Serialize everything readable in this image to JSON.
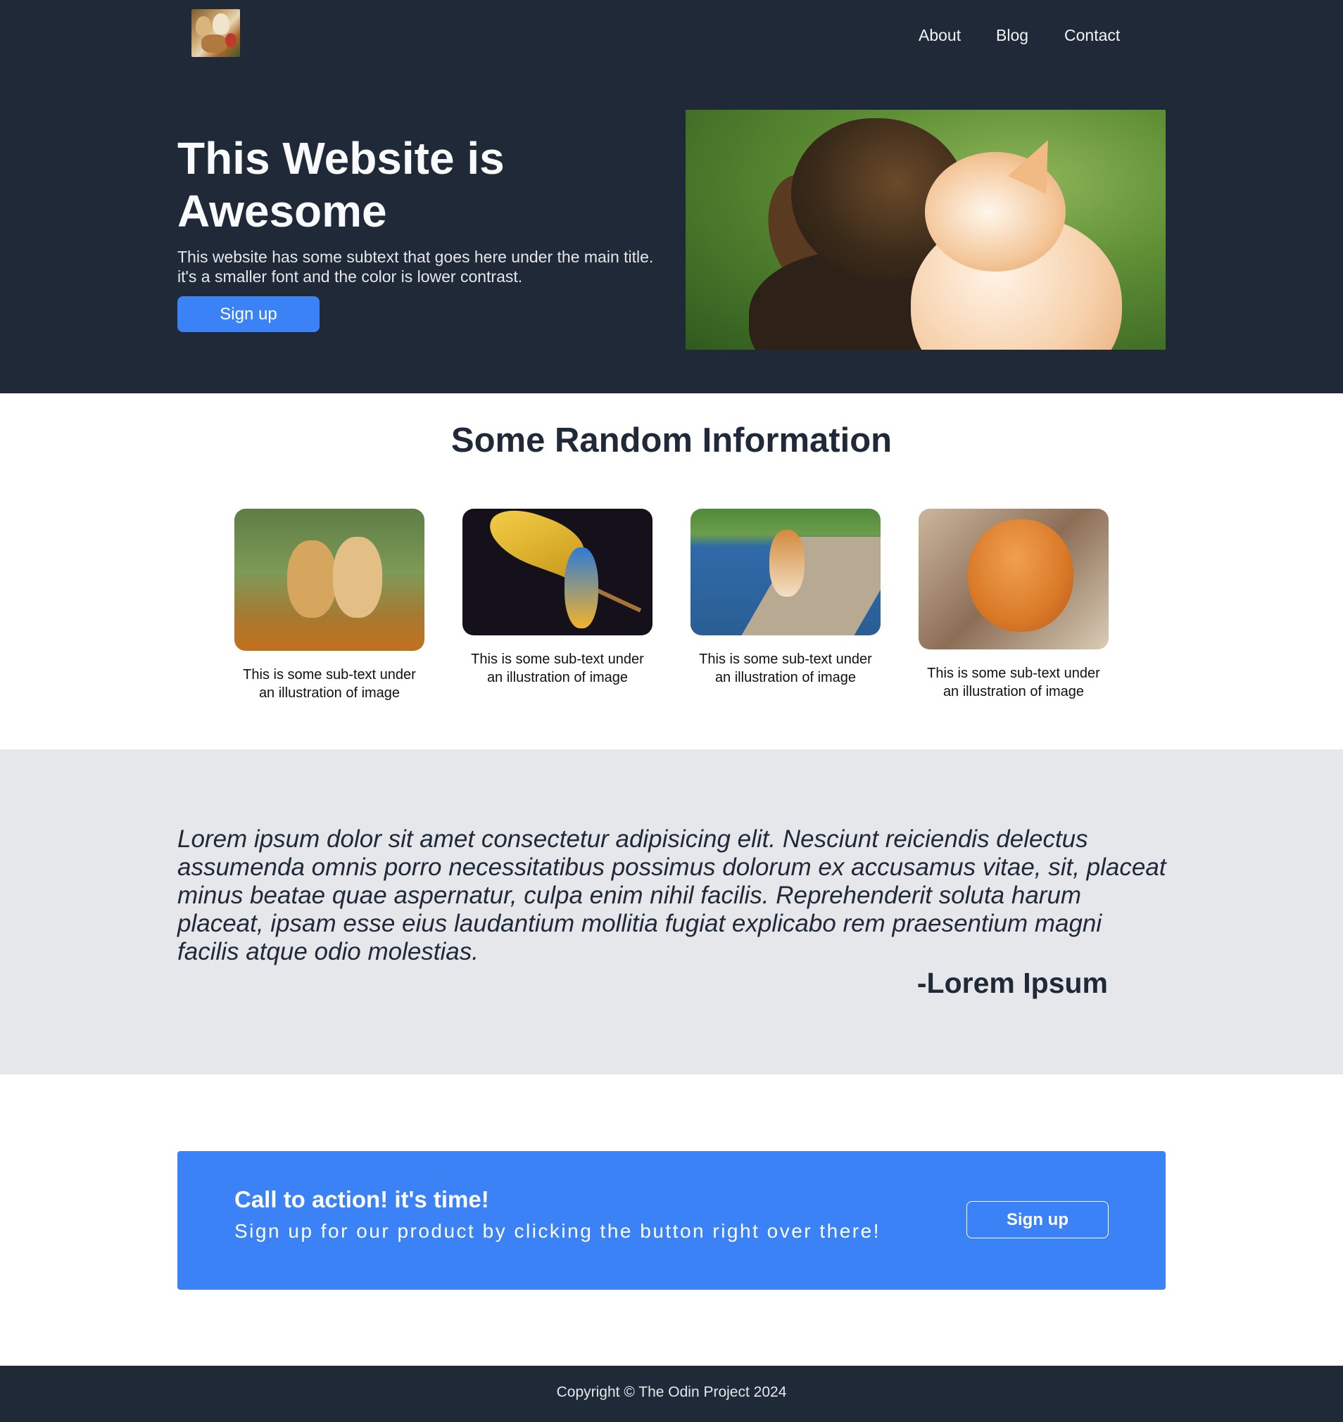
{
  "header": {
    "logo_icon": "pets-group-icon",
    "nav": {
      "about": "About",
      "blog": "Blog",
      "contact": "Contact"
    }
  },
  "hero": {
    "title": "This Website is Awesome",
    "subtitle": "This website has some subtext that goes here under the main title. it's a smaller font and the color is lower contrast.",
    "button": "Sign up",
    "image_icon": "puppy-and-kitten-image"
  },
  "info": {
    "title": "Some Random Information",
    "cards": [
      {
        "image": "puppies-image",
        "caption": "This is some sub-text under an illustration of image"
      },
      {
        "image": "parrot-image",
        "caption": "This is some sub-text under an illustration of image"
      },
      {
        "image": "corgi-image",
        "caption": "This is some sub-text under an illustration of image"
      },
      {
        "image": "cat-image",
        "caption": "This is some sub-text under an illustration of image"
      }
    ]
  },
  "quote": {
    "text": "Lorem ipsum dolor sit amet consectetur adipisicing elit. Nesciunt reiciendis delectus assumenda omnis porro necessitatibus possimus dolorum ex accusamus vitae, sit, placeat minus beatae quae aspernatur, culpa enim nihil facilis. Reprehenderit soluta harum placeat, ipsam esse eius laudantium mollitia fugiat explicabo rem praesentium magni facilis atque odio molestias.",
    "author": "-Lorem Ipsum"
  },
  "cta": {
    "title": "Call to action! it's time!",
    "subtitle": "Sign up for our product by clicking the button right over there!",
    "button": "Sign up"
  },
  "footer": {
    "copyright": "Copyright © The Odin Project 2024"
  },
  "colors": {
    "dark": "#1f2937",
    "accent": "#3b82f6",
    "quote_bg": "#e5e7eb"
  }
}
